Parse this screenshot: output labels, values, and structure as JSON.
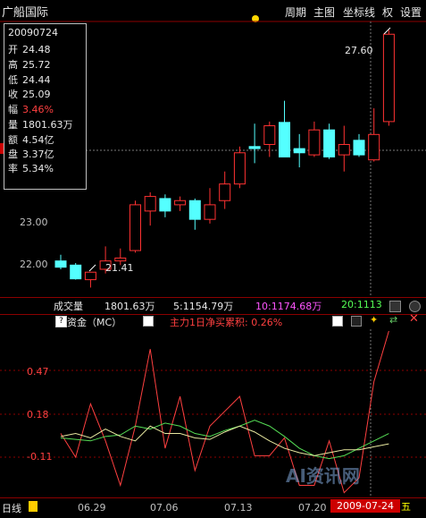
{
  "title": "广船国际",
  "menu": {
    "week": "周期",
    "main_chart": "主图",
    "crosshair": "坐标线",
    "rights": "权",
    "settings": "设置"
  },
  "info": {
    "date": "20090724",
    "open_label": "开",
    "open": "24.48",
    "high_label": "高",
    "high": "25.72",
    "low_label": "低",
    "low": "24.44",
    "close_label": "收",
    "close": "25.09",
    "change_label": "幅",
    "change": "3.46%",
    "volume_label": "量",
    "volume": "1801.63万",
    "amount_label": "额",
    "amount": "4.54亿",
    "float_label": "盘",
    "float": "3.37亿",
    "turnover_label": "率",
    "turnover": "5.34%"
  },
  "price_axis": {
    "label_23": "23.00",
    "label_22": "22.00"
  },
  "annotations": {
    "high": "27.60",
    "low": "21.41"
  },
  "volume": {
    "label": "成交量",
    "value": "1801.63万",
    "ma5": "5:1154.79万",
    "ma10": "10:1174.68万",
    "ma20": "20:1113"
  },
  "indicator": {
    "name": "资金（MC）",
    "detail": "主力1日净买累积: 0.26%",
    "axis_047": "0.47",
    "axis_018": "0.18",
    "axis_n011": "-0.11"
  },
  "bottom": {
    "period": "日线",
    "dates": [
      "06.29",
      "07.06",
      "07.13",
      "07.20"
    ],
    "selected_date": "2009-07-24",
    "weekday": "五"
  },
  "watermark": "AI资讯网",
  "chart_data": {
    "type": "candlestick",
    "candles": [
      {
        "o": 22.05,
        "h": 22.2,
        "l": 21.85,
        "c": 21.9,
        "up": false
      },
      {
        "o": 21.95,
        "h": 22.0,
        "l": 21.6,
        "c": 21.62,
        "up": false
      },
      {
        "o": 21.6,
        "h": 21.72,
        "l": 21.41,
        "c": 21.78,
        "up": true
      },
      {
        "o": 21.85,
        "h": 22.4,
        "l": 21.75,
        "c": 22.05,
        "up": true
      },
      {
        "o": 22.05,
        "h": 22.35,
        "l": 21.95,
        "c": 22.12,
        "up": true
      },
      {
        "o": 22.3,
        "h": 23.5,
        "l": 22.25,
        "c": 23.4,
        "up": true
      },
      {
        "o": 23.25,
        "h": 23.7,
        "l": 22.9,
        "c": 23.6,
        "up": true
      },
      {
        "o": 23.55,
        "h": 23.65,
        "l": 23.1,
        "c": 23.25,
        "up": false
      },
      {
        "o": 23.4,
        "h": 23.6,
        "l": 23.25,
        "c": 23.5,
        "up": true
      },
      {
        "o": 23.5,
        "h": 23.55,
        "l": 22.8,
        "c": 23.05,
        "up": false
      },
      {
        "o": 23.05,
        "h": 23.8,
        "l": 22.95,
        "c": 23.4,
        "up": true
      },
      {
        "o": 23.5,
        "h": 24.2,
        "l": 23.3,
        "c": 23.9,
        "up": true
      },
      {
        "o": 23.9,
        "h": 24.8,
        "l": 23.8,
        "c": 24.65,
        "up": true
      },
      {
        "o": 24.75,
        "h": 25.35,
        "l": 24.4,
        "c": 24.8,
        "up": false
      },
      {
        "o": 24.85,
        "h": 25.4,
        "l": 24.55,
        "c": 25.3,
        "up": true
      },
      {
        "o": 25.38,
        "h": 25.9,
        "l": 24.6,
        "c": 24.55,
        "up": false
      },
      {
        "o": 24.75,
        "h": 25.1,
        "l": 24.3,
        "c": 24.65,
        "up": false
      },
      {
        "o": 24.6,
        "h": 25.4,
        "l": 24.55,
        "c": 25.2,
        "up": true
      },
      {
        "o": 25.2,
        "h": 25.35,
        "l": 24.5,
        "c": 24.55,
        "up": false
      },
      {
        "o": 24.6,
        "h": 25.3,
        "l": 24.2,
        "c": 24.85,
        "up": true
      },
      {
        "o": 24.95,
        "h": 25.1,
        "l": 24.55,
        "c": 24.6,
        "up": false
      },
      {
        "o": 24.48,
        "h": 25.72,
        "l": 24.44,
        "c": 25.09,
        "up": true
      },
      {
        "o": 25.4,
        "h": 27.6,
        "l": 25.3,
        "c": 27.5,
        "up": true
      }
    ],
    "mc_series": {
      "red": [
        0.05,
        -0.11,
        0.25,
        0.0,
        -0.3,
        0.1,
        0.62,
        -0.05,
        0.3,
        -0.2,
        0.1,
        0.2,
        0.3,
        -0.1,
        -0.1,
        0.02,
        -0.3,
        -0.3,
        0.0,
        -0.35,
        -0.25,
        0.4,
        0.75
      ],
      "green": [
        0.02,
        0.01,
        0.0,
        0.03,
        0.04,
        0.1,
        0.08,
        0.12,
        0.1,
        0.05,
        0.03,
        0.07,
        0.1,
        0.14,
        0.1,
        0.03,
        -0.05,
        -0.1,
        -0.12,
        -0.1,
        -0.05,
        0.0,
        0.05
      ],
      "yellow": [
        0.03,
        0.05,
        0.02,
        0.08,
        0.03,
        0.0,
        0.1,
        0.05,
        0.05,
        0.02,
        0.01,
        0.06,
        0.1,
        0.06,
        0.0,
        -0.05,
        -0.08,
        -0.1,
        -0.08,
        -0.06,
        -0.06,
        -0.04,
        -0.02
      ]
    }
  }
}
